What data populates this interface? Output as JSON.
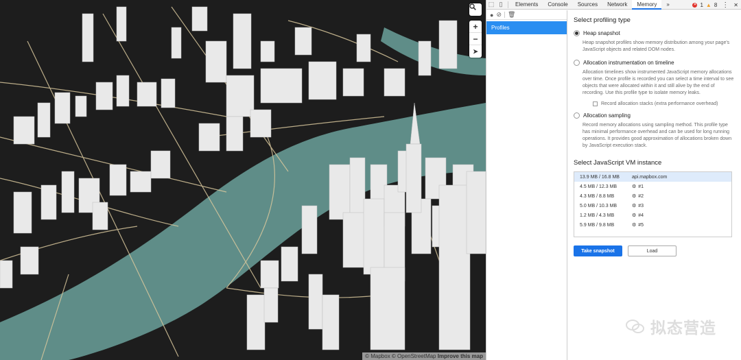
{
  "map": {
    "attribution": "© Mapbox © OpenStreetMap",
    "improve_link": "Improve this map",
    "controls": {
      "search_icon": "search-icon",
      "zoom_in": "+",
      "zoom_out": "−",
      "compass": "➤"
    },
    "colors": {
      "ground": "#1d1d1d",
      "water": "#5f8d88",
      "roads": "#d8c79c",
      "buildings": "#e9e9e9"
    }
  },
  "devtools": {
    "tabs": [
      "Elements",
      "Console",
      "Sources",
      "Network",
      "Memory"
    ],
    "active_tab": "Memory",
    "more": "»",
    "errors": "1",
    "warnings": "8",
    "menu": "⋮",
    "close": "✕",
    "sidebar": {
      "profiles_label": "Profiles"
    },
    "panel": {
      "title": "Select profiling type",
      "options": [
        {
          "label": "Heap snapshot",
          "selected": true,
          "desc": "Heap snapshot profiles show memory distribution among your page's JavaScript objects and related DOM nodes."
        },
        {
          "label": "Allocation instrumentation on timeline",
          "selected": false,
          "desc": "Allocation timelines show instrumented JavaScript memory allocations over time. Once profile is recorded you can select a time interval to see objects that were allocated within it and still alive by the end of recording. Use this profile type to isolate memory leaks.",
          "checkbox": "Record allocation stacks (extra performance overhead)"
        },
        {
          "label": "Allocation sampling",
          "selected": false,
          "desc": "Record memory allocations using sampling method. This profile type has minimal performance overhead and can be used for long running operations. It provides good approximation of allocations broken down by JavaScript execution stack."
        }
      ],
      "vm_title": "Select JavaScript VM instance",
      "vm_rows": [
        {
          "size": "13.9 MB / 16.8 MB",
          "name": "api.mapbox.com",
          "selected": true,
          "gear": false
        },
        {
          "size": "4.5 MB / 12.3 MB",
          "name": "#1",
          "selected": false,
          "gear": true
        },
        {
          "size": "4.3 MB / 8.8 MB",
          "name": "#2",
          "selected": false,
          "gear": true
        },
        {
          "size": "5.0 MB / 10.3 MB",
          "name": "#3",
          "selected": false,
          "gear": true
        },
        {
          "size": "1.2 MB / 4.3 MB",
          "name": "#4",
          "selected": false,
          "gear": true
        },
        {
          "size": "5.9 MB / 9.8 MB",
          "name": "#5",
          "selected": false,
          "gear": true
        }
      ],
      "take_snapshot": "Take snapshot",
      "load": "Load"
    }
  },
  "watermark": "拟态营造"
}
